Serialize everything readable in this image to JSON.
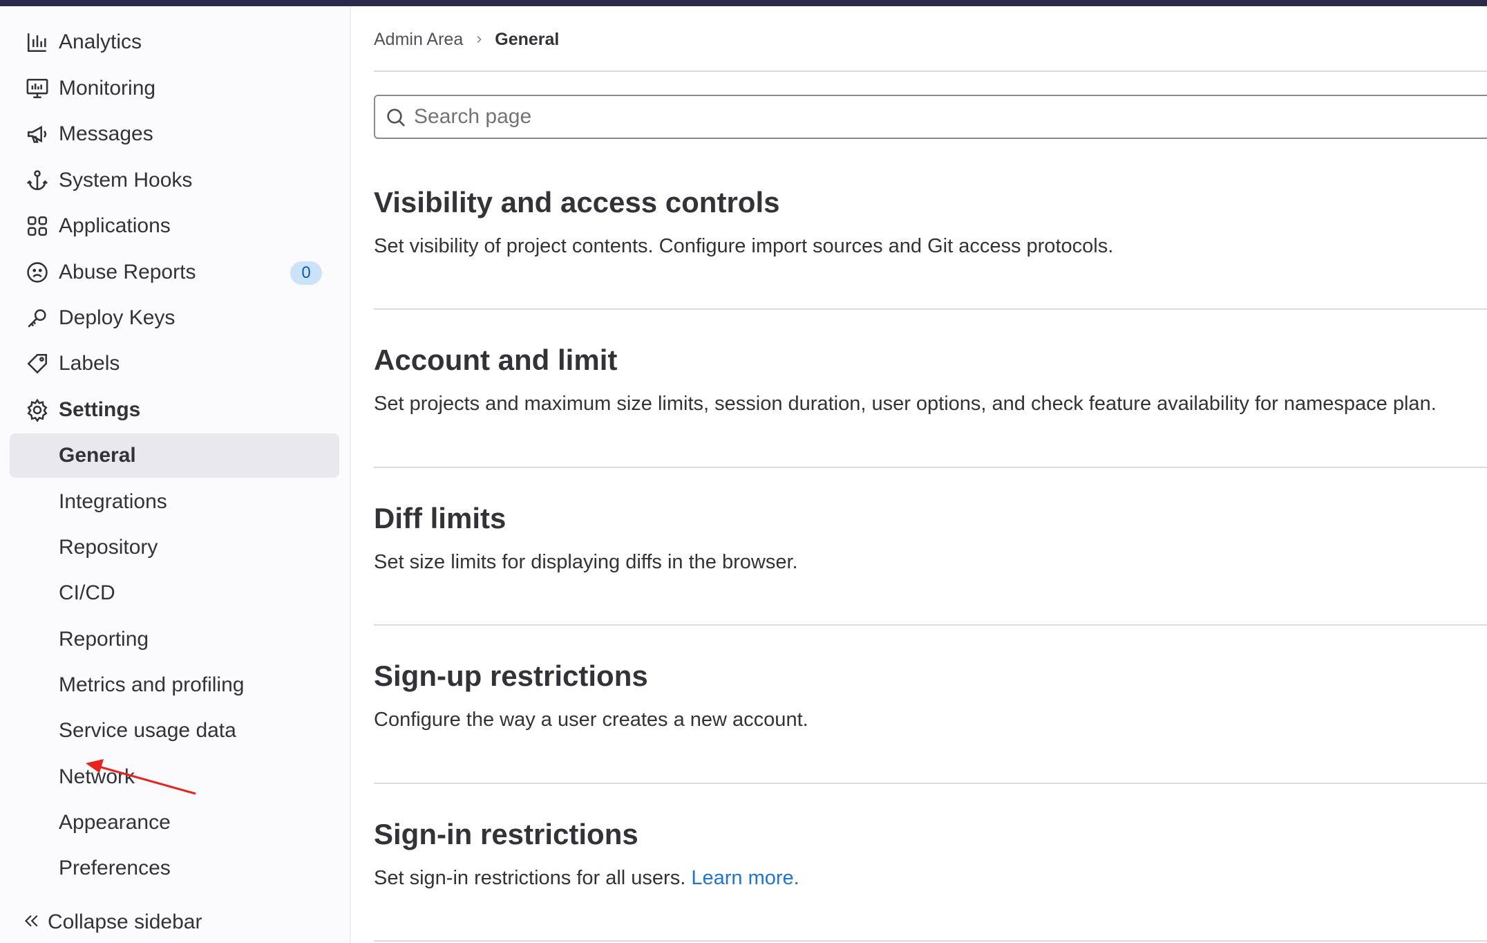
{
  "sidebar": {
    "items": [
      {
        "label": "Analytics",
        "icon": "analytics-icon"
      },
      {
        "label": "Monitoring",
        "icon": "monitor-icon"
      },
      {
        "label": "Messages",
        "icon": "megaphone-icon"
      },
      {
        "label": "System Hooks",
        "icon": "anchor-icon"
      },
      {
        "label": "Applications",
        "icon": "applications-icon"
      },
      {
        "label": "Abuse Reports",
        "icon": "abuse-icon",
        "badge": "0"
      },
      {
        "label": "Deploy Keys",
        "icon": "key-icon"
      },
      {
        "label": "Labels",
        "icon": "label-icon"
      },
      {
        "label": "Settings",
        "icon": "gear-icon"
      }
    ],
    "settings_subitems": [
      {
        "label": "General",
        "active": true
      },
      {
        "label": "Integrations"
      },
      {
        "label": "Repository"
      },
      {
        "label": "CI/CD"
      },
      {
        "label": "Reporting"
      },
      {
        "label": "Metrics and profiling"
      },
      {
        "label": "Service usage data"
      },
      {
        "label": "Network"
      },
      {
        "label": "Appearance"
      },
      {
        "label": "Preferences"
      }
    ],
    "collapse_label": "Collapse sidebar"
  },
  "breadcrumb": {
    "parent": "Admin Area",
    "current": "General"
  },
  "search": {
    "placeholder": "Search page"
  },
  "sections": [
    {
      "title": "Visibility and access controls",
      "description": "Set visibility of project contents. Configure import sources and Git access protocols."
    },
    {
      "title": "Account and limit",
      "description": "Set projects and maximum size limits, session duration, user options, and check feature availability for namespace plan."
    },
    {
      "title": "Diff limits",
      "description": "Set size limits for displaying diffs in the browser."
    },
    {
      "title": "Sign-up restrictions",
      "description": "Configure the way a user creates a new account."
    },
    {
      "title": "Sign-in restrictions",
      "description": "Set sign-in restrictions for all users.",
      "link": "Learn more."
    }
  ],
  "colors": {
    "topbar": "#2b2a4a",
    "sidebar_bg": "#fbfafd",
    "active_bg": "#e9e8ee",
    "link": "#1f75cb",
    "badge_bg": "#cbe2f9",
    "annotation_arrow": "#e8221d"
  }
}
